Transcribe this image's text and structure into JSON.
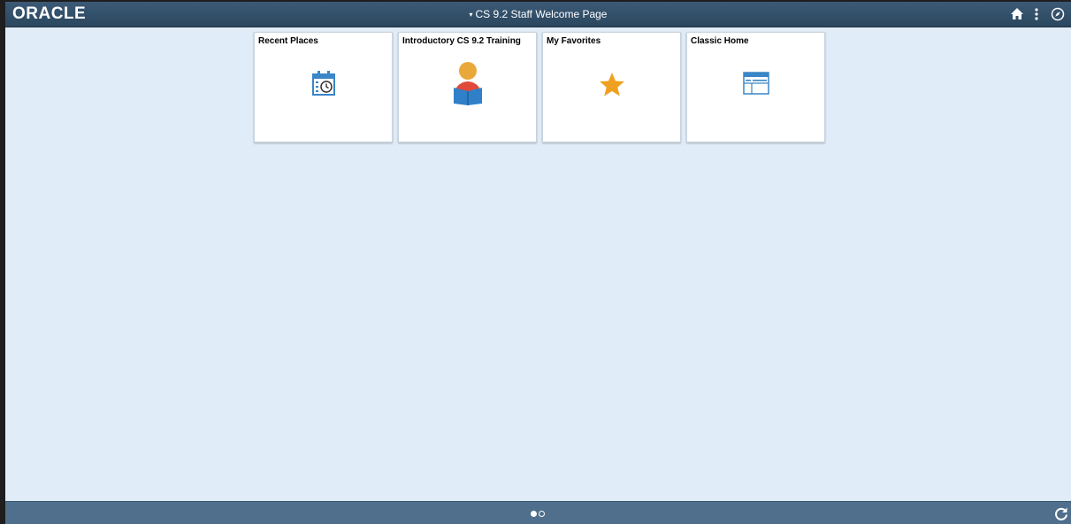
{
  "header": {
    "logo_text": "ORACLE",
    "page_title": "CS 9.2 Staff Welcome Page",
    "title_caret": "▾",
    "icons": [
      "home-icon",
      "actions-menu-icon",
      "navbar-compass-icon"
    ]
  },
  "tiles": [
    {
      "title": "Recent Places",
      "icon": "calendar-clock-icon"
    },
    {
      "title": "Introductory CS 9.2 Training",
      "icon": "person-reading-book-icon"
    },
    {
      "title": "My Favorites",
      "icon": "star-icon"
    },
    {
      "title": "Classic Home",
      "icon": "window-layout-icon"
    }
  ],
  "footer": {
    "page_indicator": {
      "pages": 2,
      "current": 1
    },
    "refresh_icon": "refresh-icon"
  },
  "colors": {
    "header_bg": "#2f4c66",
    "body_bg": "#e0ecf7",
    "footer_bg": "#4f6f8c",
    "accent_blue": "#3a86c6",
    "star": "#f0a020"
  }
}
